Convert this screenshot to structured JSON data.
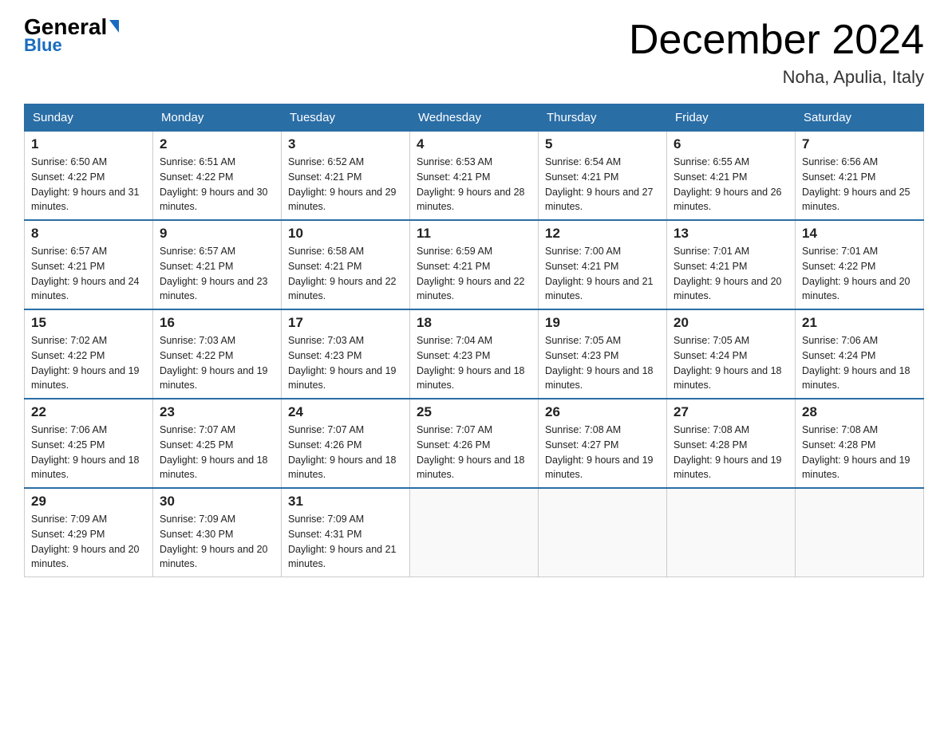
{
  "logo": {
    "general": "General",
    "triangle": "▶",
    "blue": "Blue"
  },
  "header": {
    "title": "December 2024",
    "subtitle": "Noha, Apulia, Italy"
  },
  "columns": [
    "Sunday",
    "Monday",
    "Tuesday",
    "Wednesday",
    "Thursday",
    "Friday",
    "Saturday"
  ],
  "weeks": [
    [
      {
        "day": "1",
        "sunrise": "6:50 AM",
        "sunset": "4:22 PM",
        "daylight": "9 hours and 31 minutes."
      },
      {
        "day": "2",
        "sunrise": "6:51 AM",
        "sunset": "4:22 PM",
        "daylight": "9 hours and 30 minutes."
      },
      {
        "day": "3",
        "sunrise": "6:52 AM",
        "sunset": "4:21 PM",
        "daylight": "9 hours and 29 minutes."
      },
      {
        "day": "4",
        "sunrise": "6:53 AM",
        "sunset": "4:21 PM",
        "daylight": "9 hours and 28 minutes."
      },
      {
        "day": "5",
        "sunrise": "6:54 AM",
        "sunset": "4:21 PM",
        "daylight": "9 hours and 27 minutes."
      },
      {
        "day": "6",
        "sunrise": "6:55 AM",
        "sunset": "4:21 PM",
        "daylight": "9 hours and 26 minutes."
      },
      {
        "day": "7",
        "sunrise": "6:56 AM",
        "sunset": "4:21 PM",
        "daylight": "9 hours and 25 minutes."
      }
    ],
    [
      {
        "day": "8",
        "sunrise": "6:57 AM",
        "sunset": "4:21 PM",
        "daylight": "9 hours and 24 minutes."
      },
      {
        "day": "9",
        "sunrise": "6:57 AM",
        "sunset": "4:21 PM",
        "daylight": "9 hours and 23 minutes."
      },
      {
        "day": "10",
        "sunrise": "6:58 AM",
        "sunset": "4:21 PM",
        "daylight": "9 hours and 22 minutes."
      },
      {
        "day": "11",
        "sunrise": "6:59 AM",
        "sunset": "4:21 PM",
        "daylight": "9 hours and 22 minutes."
      },
      {
        "day": "12",
        "sunrise": "7:00 AM",
        "sunset": "4:21 PM",
        "daylight": "9 hours and 21 minutes."
      },
      {
        "day": "13",
        "sunrise": "7:01 AM",
        "sunset": "4:21 PM",
        "daylight": "9 hours and 20 minutes."
      },
      {
        "day": "14",
        "sunrise": "7:01 AM",
        "sunset": "4:22 PM",
        "daylight": "9 hours and 20 minutes."
      }
    ],
    [
      {
        "day": "15",
        "sunrise": "7:02 AM",
        "sunset": "4:22 PM",
        "daylight": "9 hours and 19 minutes."
      },
      {
        "day": "16",
        "sunrise": "7:03 AM",
        "sunset": "4:22 PM",
        "daylight": "9 hours and 19 minutes."
      },
      {
        "day": "17",
        "sunrise": "7:03 AM",
        "sunset": "4:23 PM",
        "daylight": "9 hours and 19 minutes."
      },
      {
        "day": "18",
        "sunrise": "7:04 AM",
        "sunset": "4:23 PM",
        "daylight": "9 hours and 18 minutes."
      },
      {
        "day": "19",
        "sunrise": "7:05 AM",
        "sunset": "4:23 PM",
        "daylight": "9 hours and 18 minutes."
      },
      {
        "day": "20",
        "sunrise": "7:05 AM",
        "sunset": "4:24 PM",
        "daylight": "9 hours and 18 minutes."
      },
      {
        "day": "21",
        "sunrise": "7:06 AM",
        "sunset": "4:24 PM",
        "daylight": "9 hours and 18 minutes."
      }
    ],
    [
      {
        "day": "22",
        "sunrise": "7:06 AM",
        "sunset": "4:25 PM",
        "daylight": "9 hours and 18 minutes."
      },
      {
        "day": "23",
        "sunrise": "7:07 AM",
        "sunset": "4:25 PM",
        "daylight": "9 hours and 18 minutes."
      },
      {
        "day": "24",
        "sunrise": "7:07 AM",
        "sunset": "4:26 PM",
        "daylight": "9 hours and 18 minutes."
      },
      {
        "day": "25",
        "sunrise": "7:07 AM",
        "sunset": "4:26 PM",
        "daylight": "9 hours and 18 minutes."
      },
      {
        "day": "26",
        "sunrise": "7:08 AM",
        "sunset": "4:27 PM",
        "daylight": "9 hours and 19 minutes."
      },
      {
        "day": "27",
        "sunrise": "7:08 AM",
        "sunset": "4:28 PM",
        "daylight": "9 hours and 19 minutes."
      },
      {
        "day": "28",
        "sunrise": "7:08 AM",
        "sunset": "4:28 PM",
        "daylight": "9 hours and 19 minutes."
      }
    ],
    [
      {
        "day": "29",
        "sunrise": "7:09 AM",
        "sunset": "4:29 PM",
        "daylight": "9 hours and 20 minutes."
      },
      {
        "day": "30",
        "sunrise": "7:09 AM",
        "sunset": "4:30 PM",
        "daylight": "9 hours and 20 minutes."
      },
      {
        "day": "31",
        "sunrise": "7:09 AM",
        "sunset": "4:31 PM",
        "daylight": "9 hours and 21 minutes."
      },
      null,
      null,
      null,
      null
    ]
  ]
}
